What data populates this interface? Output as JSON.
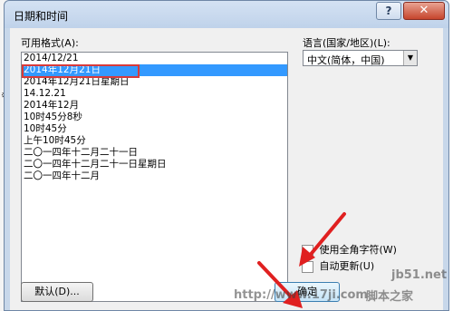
{
  "background": {
    "glyphs": [
      "〈",
      "※",
      "〈",
      "〈",
      "〈",
      "〈",
      "〈"
    ]
  },
  "dialog": {
    "title": "日期和时间",
    "help_label": "?",
    "close_label": "✕"
  },
  "formats": {
    "label": "可用格式(A):",
    "items": [
      "2014/12/21",
      "2014年12月21日",
      "2014年12月21日星期日",
      "14.12.21",
      "2014年12月",
      "10时45分8秒",
      "10时45分",
      "上午10时45分",
      "二〇一四年十二月二十一日",
      "二〇一四年十二月二十一日星期日",
      "二〇一四年十二月"
    ],
    "selected_index": 1
  },
  "language": {
    "label": "语言(国家/地区)(L):",
    "value": "中文(简体，中国)"
  },
  "options": {
    "fullwidth_label": "使用全角字符(W)",
    "autoupdate_label": "自动更新(U)"
  },
  "buttons": {
    "default_label": "默认(D)...",
    "ok_label": "确定"
  },
  "watermark": {
    "site": "jb51.net",
    "url": "http://www.17ji.com",
    "brand": "脚本之家"
  },
  "colors": {
    "selection": "#3399ff",
    "highlight_box": "#d83a3a",
    "arrow": "#e02020"
  }
}
